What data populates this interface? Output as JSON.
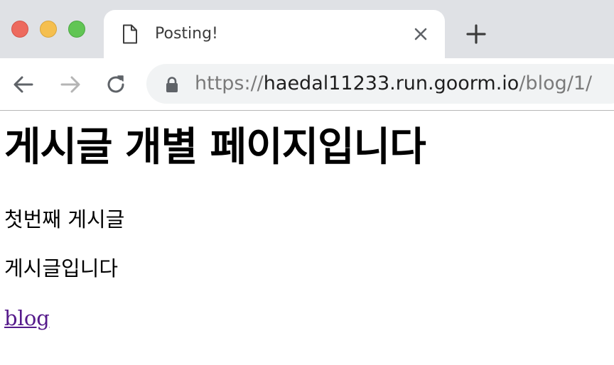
{
  "window": {
    "traffic_lights": {
      "close_color": "#ed6a5e",
      "minimize_color": "#f5bf4f",
      "zoom_color": "#61c554"
    }
  },
  "tab": {
    "title": "Posting!",
    "icon": "document-icon",
    "close_icon": "close-icon"
  },
  "new_tab_icon": "plus-icon",
  "toolbar": {
    "back_icon": "arrow-left-icon",
    "forward_icon": "arrow-right-icon",
    "reload_icon": "reload-icon",
    "url_scheme": "https://",
    "url_host": "haedal11233.run.goorm.io",
    "url_path": "/blog/1/",
    "lock_icon": "lock-icon"
  },
  "page": {
    "heading": "게시글 개별 페이지입니다",
    "post_title": "첫번째 게시글",
    "post_body": "게시글입니다",
    "link_text": "blog",
    "link_color": "#551a8b"
  }
}
